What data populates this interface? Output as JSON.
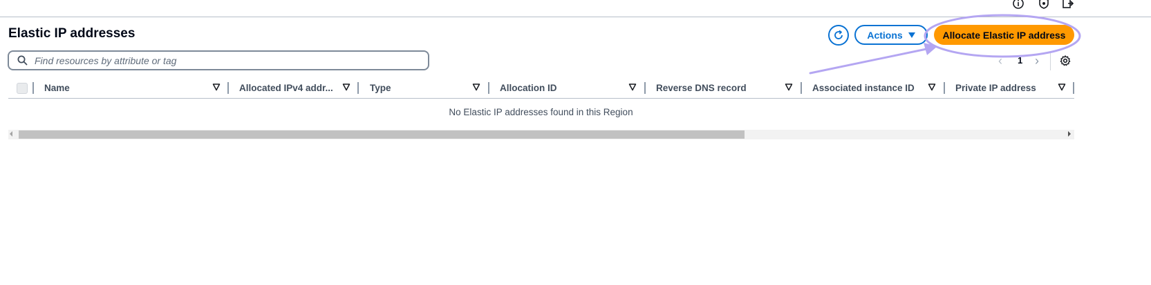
{
  "page": {
    "title": "Elastic IP addresses"
  },
  "toolbar": {
    "actions_label": "Actions",
    "allocate_label": "Allocate Elastic IP address"
  },
  "search": {
    "placeholder": "Find resources by attribute or tag"
  },
  "pagination": {
    "current_page": "1"
  },
  "table": {
    "columns": [
      "Name",
      "Allocated IPv4 addr...",
      "Type",
      "Allocation ID",
      "Reverse DNS record",
      "Associated instance ID",
      "Private IP address"
    ],
    "empty_message": "No Elastic IP addresses found in this Region"
  },
  "icons": {
    "top_bar": [
      "info-icon",
      "shield-icon",
      "export-icon"
    ],
    "refresh": "refresh-icon",
    "search": "search-icon",
    "settings": "gear-icon",
    "filter": "filter-triangle-icon"
  },
  "colors": {
    "primary_button": "#ff9900",
    "link_blue": "#0972d3",
    "annotation": "#b4a6f2"
  },
  "annotation": {
    "type": "circle-with-arrow",
    "target": "allocate-elastic-ip-button"
  }
}
